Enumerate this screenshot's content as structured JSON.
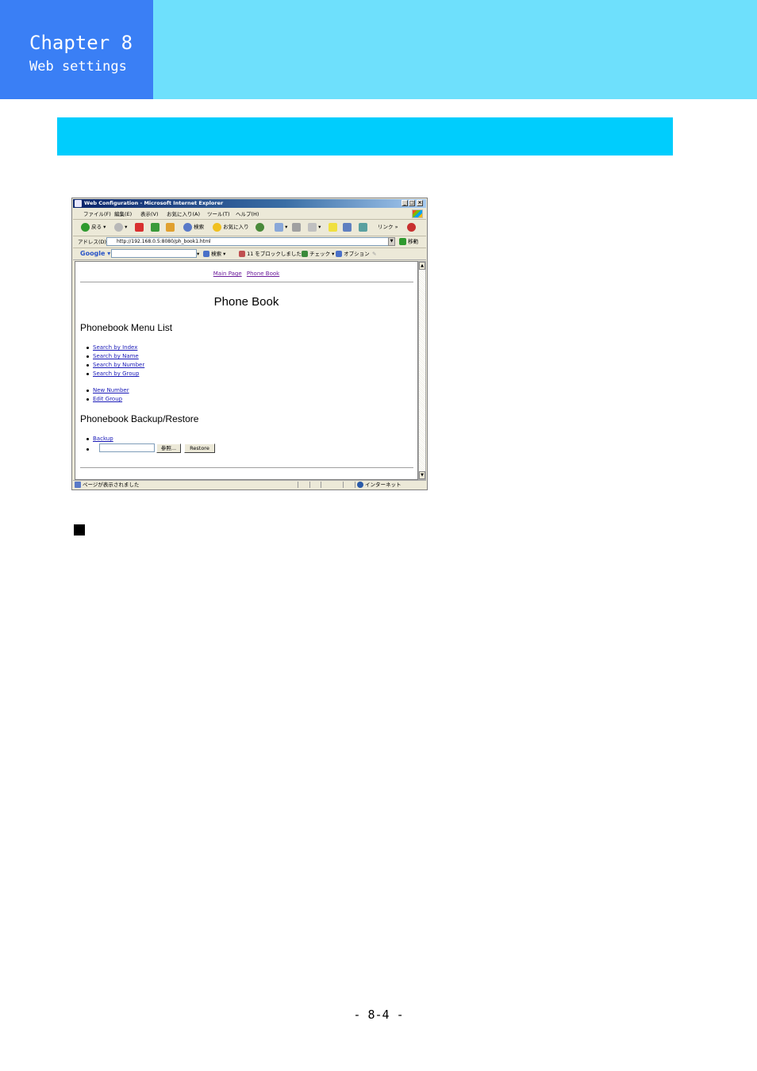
{
  "header": {
    "chapter": "Chapter 8",
    "subtitle": "Web settings",
    "colors": {
      "chapter_box": "#3a7ff5",
      "band": "#6ee0fc",
      "section_bar": "#00cdfd"
    }
  },
  "browser": {
    "title": "Web Configuration - Microsoft Internet Explorer",
    "window_buttons": [
      "_",
      "□",
      "×"
    ],
    "menu": [
      "ファイル(F)",
      "編集(E)",
      "表示(V)",
      "お気に入り(A)",
      "ツール(T)",
      "ヘルプ(H)"
    ],
    "toolbar": {
      "back": "戻る",
      "search": "検索",
      "favorites": "お気に入り",
      "links": "リンク",
      "more": "»"
    },
    "address": {
      "label": "アドレス(D)",
      "url": "http://192.168.0.5:8080/ph_book1.html",
      "go": "移動"
    },
    "google_bar": {
      "logo": "Google",
      "search_button": "検索",
      "blocked": "11 をブロックしました",
      "check": "チェック",
      "options": "オプション"
    },
    "page": {
      "nav_links": [
        "Main Page",
        "Phone Book"
      ],
      "title": "Phone Book",
      "menu_heading": "Phonebook Menu List",
      "search_links": [
        "Search by Index",
        "Search by Name",
        "Search by Number",
        "Search by Group"
      ],
      "edit_links": [
        "New Number",
        "Edit Group"
      ],
      "backup_heading": "Phonebook Backup/Restore",
      "backup_link": "Backup",
      "browse_button": "参照...",
      "restore_button": "Restore"
    },
    "status": {
      "text": "ページが表示されました",
      "zone": "インターネット"
    }
  },
  "footer": {
    "page_number": "- 8-4 -"
  }
}
